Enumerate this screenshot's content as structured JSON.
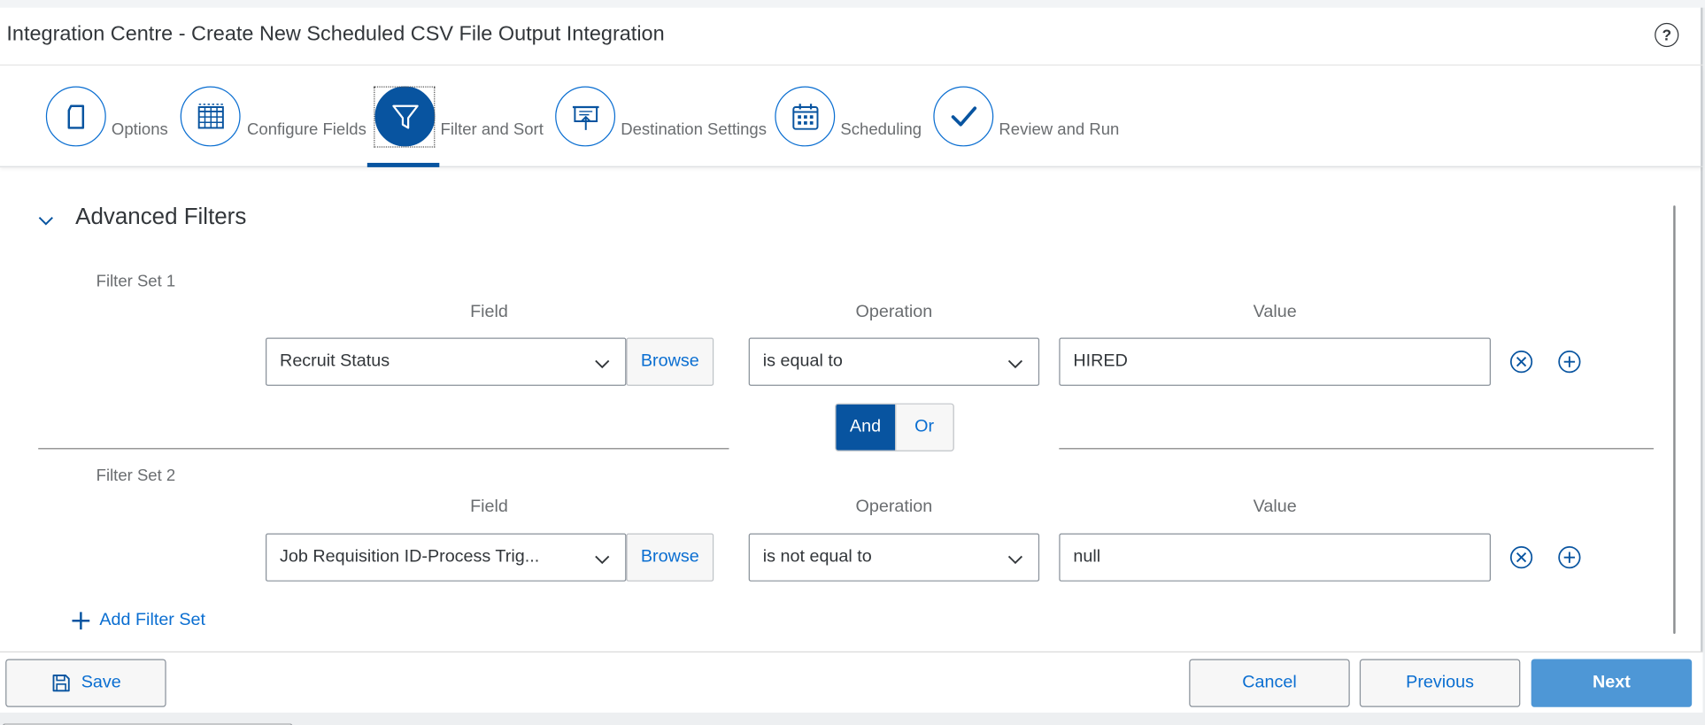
{
  "header": {
    "title": "Integration Centre - Create New Scheduled CSV File Output Integration",
    "help_glyph": "?"
  },
  "wizard": {
    "steps": [
      {
        "label": "Options",
        "icon": "document-icon",
        "active": false
      },
      {
        "label": "Configure Fields",
        "icon": "grid-icon",
        "active": false
      },
      {
        "label": "Filter and Sort",
        "icon": "filter-icon",
        "active": true
      },
      {
        "label": "Destination Settings",
        "icon": "presentation-upload-icon",
        "active": false
      },
      {
        "label": "Scheduling",
        "icon": "calendar-icon",
        "active": false
      },
      {
        "label": "Review and Run",
        "icon": "checkmark-icon",
        "active": false
      }
    ]
  },
  "advanced_filters": {
    "title": "Advanced Filters",
    "filter_sets": [
      {
        "label": "Filter Set 1",
        "headers": {
          "field": "Field",
          "operation": "Operation",
          "value": "Value"
        },
        "field": "Recruit Status",
        "browse_label": "Browse",
        "operation": "is equal to",
        "value": "HIRED"
      },
      {
        "label": "Filter Set 2",
        "headers": {
          "field": "Field",
          "operation": "Operation",
          "value": "Value"
        },
        "field": "Job Requisition ID-Process Trig...",
        "browse_label": "Browse",
        "operation": "is not equal to",
        "value": "null"
      }
    ],
    "logic": {
      "and_label": "And",
      "or_label": "Or",
      "selected": "And"
    },
    "add_filter_set_label": "Add Filter Set"
  },
  "footer": {
    "save_label": "Save",
    "cancel_label": "Cancel",
    "previous_label": "Previous",
    "next_label": "Next"
  },
  "colors": {
    "accent": "#0854a0",
    "link": "#0a6ed1",
    "primary_button": "#4e97d6"
  }
}
